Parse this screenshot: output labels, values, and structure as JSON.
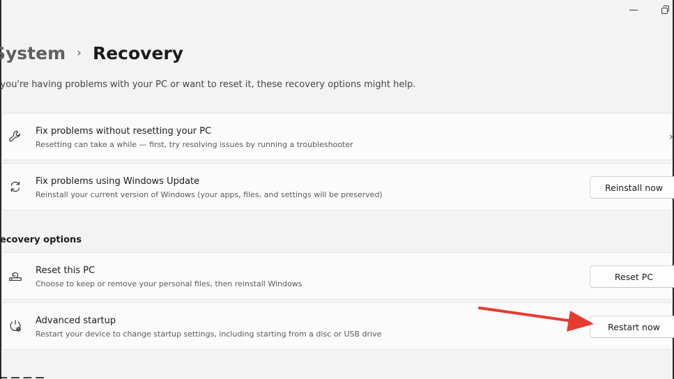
{
  "breadcrumb": {
    "parent": "System",
    "separator": "›",
    "current": "Recovery"
  },
  "intro_text": "If you're having problems with your PC or want to reset it, these recovery options might help.",
  "cards_top": [
    {
      "title": "Fix problems without resetting your PC",
      "description": "Resetting can take a while — first, try resolving issues by running a troubleshooter",
      "icon": "wrench-icon",
      "action": "chevron"
    },
    {
      "title": "Fix problems using Windows Update",
      "description": "Reinstall your current version of Windows (your apps, files, and settings will be preserved)",
      "icon": "sync-icon",
      "button_label": "Reinstall now"
    }
  ],
  "section_label": "Recovery options",
  "cards_recovery": [
    {
      "title": "Reset this PC",
      "description": "Choose to keep or remove your personal files, then reinstall Windows",
      "icon": "reset-pc-icon",
      "button_label": "Reset PC"
    },
    {
      "title": "Advanced startup",
      "description": "Restart your device to change startup settings, including starting from a disc or USB drive",
      "icon": "startup-gear-icon",
      "button_label": "Restart now"
    }
  ],
  "annotation": {
    "arrow_color": "#e8392f",
    "target": "Restart now"
  },
  "colors": {
    "background": "#f3f3f3",
    "card": "#fbfbfb",
    "card_border": "#e5e5e5"
  }
}
